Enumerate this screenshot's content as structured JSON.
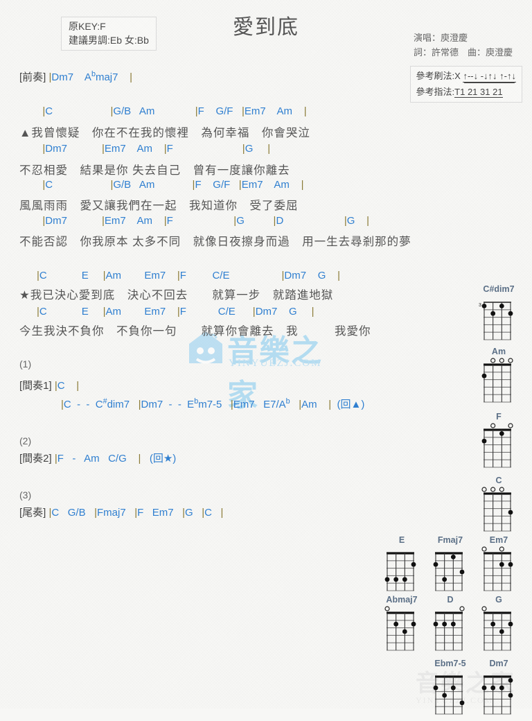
{
  "header": {
    "title": "愛到底",
    "key_lines": [
      "原KEY:F",
      "建議男調:Eb 女:Bb"
    ],
    "credits": [
      "演唱：庾澄慶",
      "詞：許常德　曲：庾澄慶"
    ],
    "strum_label": "參考刷法:X",
    "strum_pattern": "↑--↓ -↓↑↓ ↑-↑↓",
    "finger_label": "參考指法:",
    "finger_pattern": "T1 21 31 21"
  },
  "watermark": {
    "cn": "音樂之家",
    "url": "YINYUEZJ.COM"
  },
  "sections": {
    "prelude_label": "[前奏]",
    "prelude_chords": "|Dm7    A♭maj7    |",
    "interlude1_num": "(1)",
    "interlude1_label": "[間奏1]",
    "interlude1_chords": "|C    |",
    "interlude1_chords2": "|C  -  -  C#dim7   |Dm7  -  -  E♭m7-5   |Em7   E7/A♭   |Am    |  (回▲)",
    "interlude2_num": "(2)",
    "interlude2_label": "[間奏2]",
    "interlude2_chords": "|F   -   Am   C/G    |   (回★)",
    "outro_num": "(3)",
    "outro_label": "[尾奏]",
    "outro_chords": "|C   G/B   |Fmaj7   |F   Em7   |G   |C   |"
  },
  "verses": [
    {
      "chords": "        |C                    |G/B   Am              |F    G/F   |Em7    Am    |",
      "lyrics": "▲我曾懷疑　你在不在我的懷裡　為何幸福　你會哭泣"
    },
    {
      "chords": "        |Dm7            |Em7    Am    |F                        |G     |",
      "lyrics": "不忍相愛　結果是你 失去自己　曾有一度讓你離去"
    },
    {
      "chords": "        |C                    |G/B   Am             |F    G/F   |Em7    Am    |",
      "lyrics": "風風雨雨　愛又讓我們在一起　我知道你　受了委屈"
    },
    {
      "chords": "        |Dm7            |Em7    Am    |F                     |G          |D                     |G    |",
      "lyrics": "不能否認　你我原本 太多不同　就像日夜擦身而過　用一生去尋剎那的夢"
    }
  ],
  "chorus": [
    {
      "chords": "      |C            E     |Am        Em7    |F         C/E                  |Dm7    G    |",
      "lyrics": "★我已決心愛到底　決心不回去　　就算一步　就踏進地獄"
    },
    {
      "chords": "      |C            E     |Am        Em7    |F           C/E      |Dm7    G     |",
      "lyrics": "今生我決不負你　不負你一句　　就算你會離去　我　　　我愛你"
    }
  ],
  "diagrams": [
    {
      "name": "C#dim7",
      "fret_label": "3",
      "open": [
        0,
        0,
        0,
        0
      ],
      "dots": [
        [
          1,
          1
        ],
        [
          1,
          3
        ],
        [
          2,
          2
        ],
        [
          2,
          4
        ]
      ]
    },
    {
      "name": "Am",
      "fret_label": "",
      "open": [
        0,
        1,
        1,
        1
      ],
      "dots": [
        [
          2,
          1
        ]
      ]
    },
    {
      "name": "F",
      "fret_label": "",
      "open": [
        0,
        1,
        0,
        1
      ],
      "dots": [
        [
          1,
          3
        ],
        [
          2,
          1
        ]
      ]
    },
    {
      "name": "C",
      "fret_label": "",
      "open": [
        1,
        1,
        1,
        0
      ],
      "dots": [
        [
          3,
          4
        ]
      ]
    },
    {
      "name": "E",
      "fret_label": "",
      "open": [
        0,
        0,
        0,
        0
      ],
      "dots": [
        [
          2,
          4
        ],
        [
          4,
          1
        ],
        [
          4,
          2
        ],
        [
          4,
          3
        ]
      ]
    },
    {
      "name": "Fmaj7",
      "fret_label": "",
      "open": [
        0,
        0,
        0,
        0
      ],
      "dots": [
        [
          1,
          3
        ],
        [
          2,
          1
        ],
        [
          3,
          4
        ],
        [
          4,
          2
        ]
      ]
    },
    {
      "name": "Em7",
      "fret_label": "",
      "open": [
        1,
        0,
        1,
        0
      ],
      "dots": [
        [
          2,
          3
        ],
        [
          2,
          4
        ]
      ]
    },
    {
      "name": "Abmaj7",
      "fret_label": "",
      "open": [
        1,
        0,
        0,
        0
      ],
      "dots": [
        [
          2,
          2
        ],
        [
          2,
          4
        ],
        [
          3,
          3
        ]
      ]
    },
    {
      "name": "D",
      "fret_label": "",
      "open": [
        0,
        0,
        0,
        1
      ],
      "dots": [
        [
          2,
          1
        ],
        [
          2,
          2
        ],
        [
          2,
          3
        ]
      ]
    },
    {
      "name": "G",
      "fret_label": "",
      "open": [
        1,
        0,
        0,
        0
      ],
      "dots": [
        [
          2,
          2
        ],
        [
          2,
          4
        ],
        [
          3,
          3
        ]
      ]
    },
    {
      "name": "Ebm7-5",
      "fret_label": "",
      "open": [
        0,
        0,
        0,
        0
      ],
      "dots": [
        [
          2,
          1
        ],
        [
          2,
          3
        ],
        [
          3,
          2
        ],
        [
          4,
          4
        ]
      ]
    },
    {
      "name": "Dm7",
      "fret_label": "",
      "open": [
        0,
        0,
        0,
        0
      ],
      "dots": [
        [
          1,
          4
        ],
        [
          2,
          1
        ],
        [
          2,
          2
        ],
        [
          2,
          3
        ],
        [
          3,
          4
        ]
      ]
    }
  ]
}
